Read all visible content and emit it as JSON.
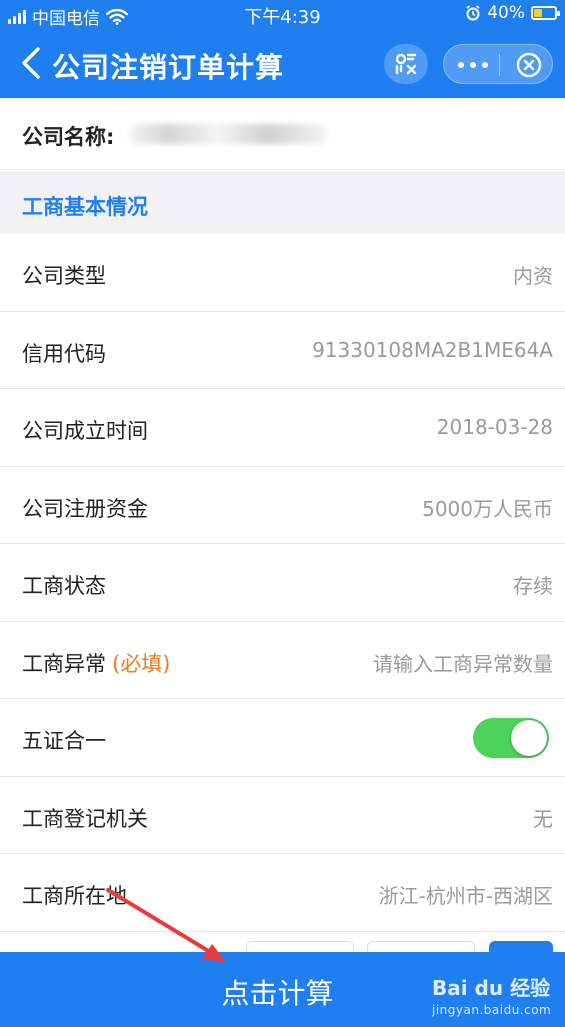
{
  "status_bar": {
    "carrier": "中国电信",
    "time": "下午4:39",
    "battery": "40%",
    "battery_level": 0.4
  },
  "header": {
    "title": "公司注销订单计算",
    "icons": [
      "chevron-left-icon",
      "scan-icon",
      "more-icon",
      "close-icon"
    ]
  },
  "company": {
    "label": "公司名称:"
  },
  "section": {
    "title": "工商基本情况"
  },
  "rows": [
    {
      "label": "公司类型",
      "value": "内资"
    },
    {
      "label": "信用代码",
      "value": "91330108MA2B1ME64A"
    },
    {
      "label": "公司成立时间",
      "value": "2018-03-28"
    },
    {
      "label": "公司注册资金",
      "value": "5000万人民币"
    },
    {
      "label": "工商状态",
      "value": "存续"
    },
    {
      "label": "工商异常",
      "required": "(必填)",
      "placeholder": "请输入工商异常数量"
    },
    {
      "label": "五证合一",
      "toggle_on": true
    },
    {
      "label": "工商登记机关",
      "value": "无"
    },
    {
      "label": "工商所在地",
      "value": "浙江-杭州市-西湖区"
    }
  ],
  "footer": {
    "button_label": "点击计算"
  },
  "watermark": {
    "logo": "Bai du 经验",
    "url": "jingyan.baidu.com"
  },
  "colors": {
    "primary": "#1f7ff0",
    "required": "#f07a1d",
    "toggle_on": "#4cd35a",
    "section_bg": "#f2f2f4",
    "annotation_arrow": "#e83b3b"
  }
}
